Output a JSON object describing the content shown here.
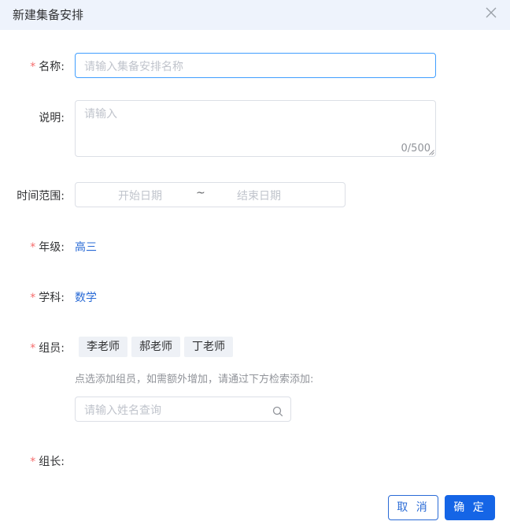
{
  "dialog": {
    "title": "新建集备安排"
  },
  "form": {
    "name": {
      "label": "名称:",
      "required": "*",
      "placeholder": "请输入集备安排名称"
    },
    "description": {
      "label": "说明:",
      "placeholder": "请输入",
      "counter": "0/500"
    },
    "time_range": {
      "label": "时间范围:",
      "start_placeholder": "开始日期",
      "separator": "~",
      "end_placeholder": "结束日期"
    },
    "grade": {
      "label": "年级:",
      "required": "*",
      "value": "高三"
    },
    "subject": {
      "label": "学科:",
      "required": "*",
      "value": "数学"
    },
    "members": {
      "label": "组员:",
      "required": "*",
      "tags": [
        "李老师",
        "郝老师",
        "丁老师"
      ],
      "hint": "点选添加组员，如需额外增加，请通过下方检索添加:",
      "search_placeholder": "请输入姓名查询"
    },
    "leader": {
      "label": "组长:",
      "required": "*"
    }
  },
  "footer": {
    "cancel_label": "取 消",
    "ok_label": "确 定"
  },
  "colors": {
    "accent": "#1565e6",
    "required": "#f56c6c",
    "header_bg": "#eef3fc"
  }
}
